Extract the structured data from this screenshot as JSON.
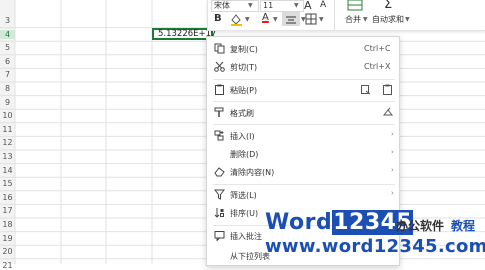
{
  "sheet": {
    "rows": [
      "3",
      "4",
      "5",
      "6",
      "7",
      "8",
      "9",
      "10",
      "11",
      "12",
      "13",
      "14",
      "15",
      "16",
      "17",
      "18",
      "19",
      "20",
      "21"
    ],
    "active_row": "4",
    "active_cell_value": "5.13226E+17"
  },
  "toolbar": {
    "font_name": "宋体",
    "font_size": "11",
    "bold_label": "B",
    "font_color_label": "A",
    "merge_label": "合并",
    "autosum_label": "自动求和",
    "sum_symbol": "Σ",
    "grow_font_label": "A",
    "shrink_font_label": "A"
  },
  "context_menu": {
    "items": [
      {
        "label": "复制(C)",
        "shortcut": "Ctrl+C",
        "icon": "copy-icon"
      },
      {
        "label": "剪切(T)",
        "shortcut": "Ctrl+X",
        "icon": "scissors-icon"
      },
      {
        "label": "粘贴(P)",
        "icon": "paste-icon"
      },
      {
        "label": "格式刷",
        "icon": "format-painter-icon"
      },
      {
        "label": "插入(I)",
        "icon": "insert-icon",
        "submenu": true
      },
      {
        "label": "删除(D)",
        "icon": "delete-icon",
        "submenu": true
      },
      {
        "label": "清除内容(N)",
        "icon": "clear-icon",
        "submenu": true
      },
      {
        "label": "筛选(L)",
        "icon": "filter-icon",
        "submenu": true
      },
      {
        "label": "排序(U)",
        "icon": "sort-icon",
        "submenu": true
      },
      {
        "label": "插入批注",
        "icon": "comment-icon"
      },
      {
        "label": "从下拉列表",
        "icon": "dropdown-list-icon"
      }
    ]
  },
  "watermark": {
    "brand_prefix": "Word",
    "brand_digits": "12345",
    "tagline_office": "办公软件",
    "tagline_tutorial": "教程",
    "url": "www.word12345.com"
  },
  "colors": {
    "selection_border": "#1e7b34",
    "watermark_blue": "#1b4fb3"
  }
}
